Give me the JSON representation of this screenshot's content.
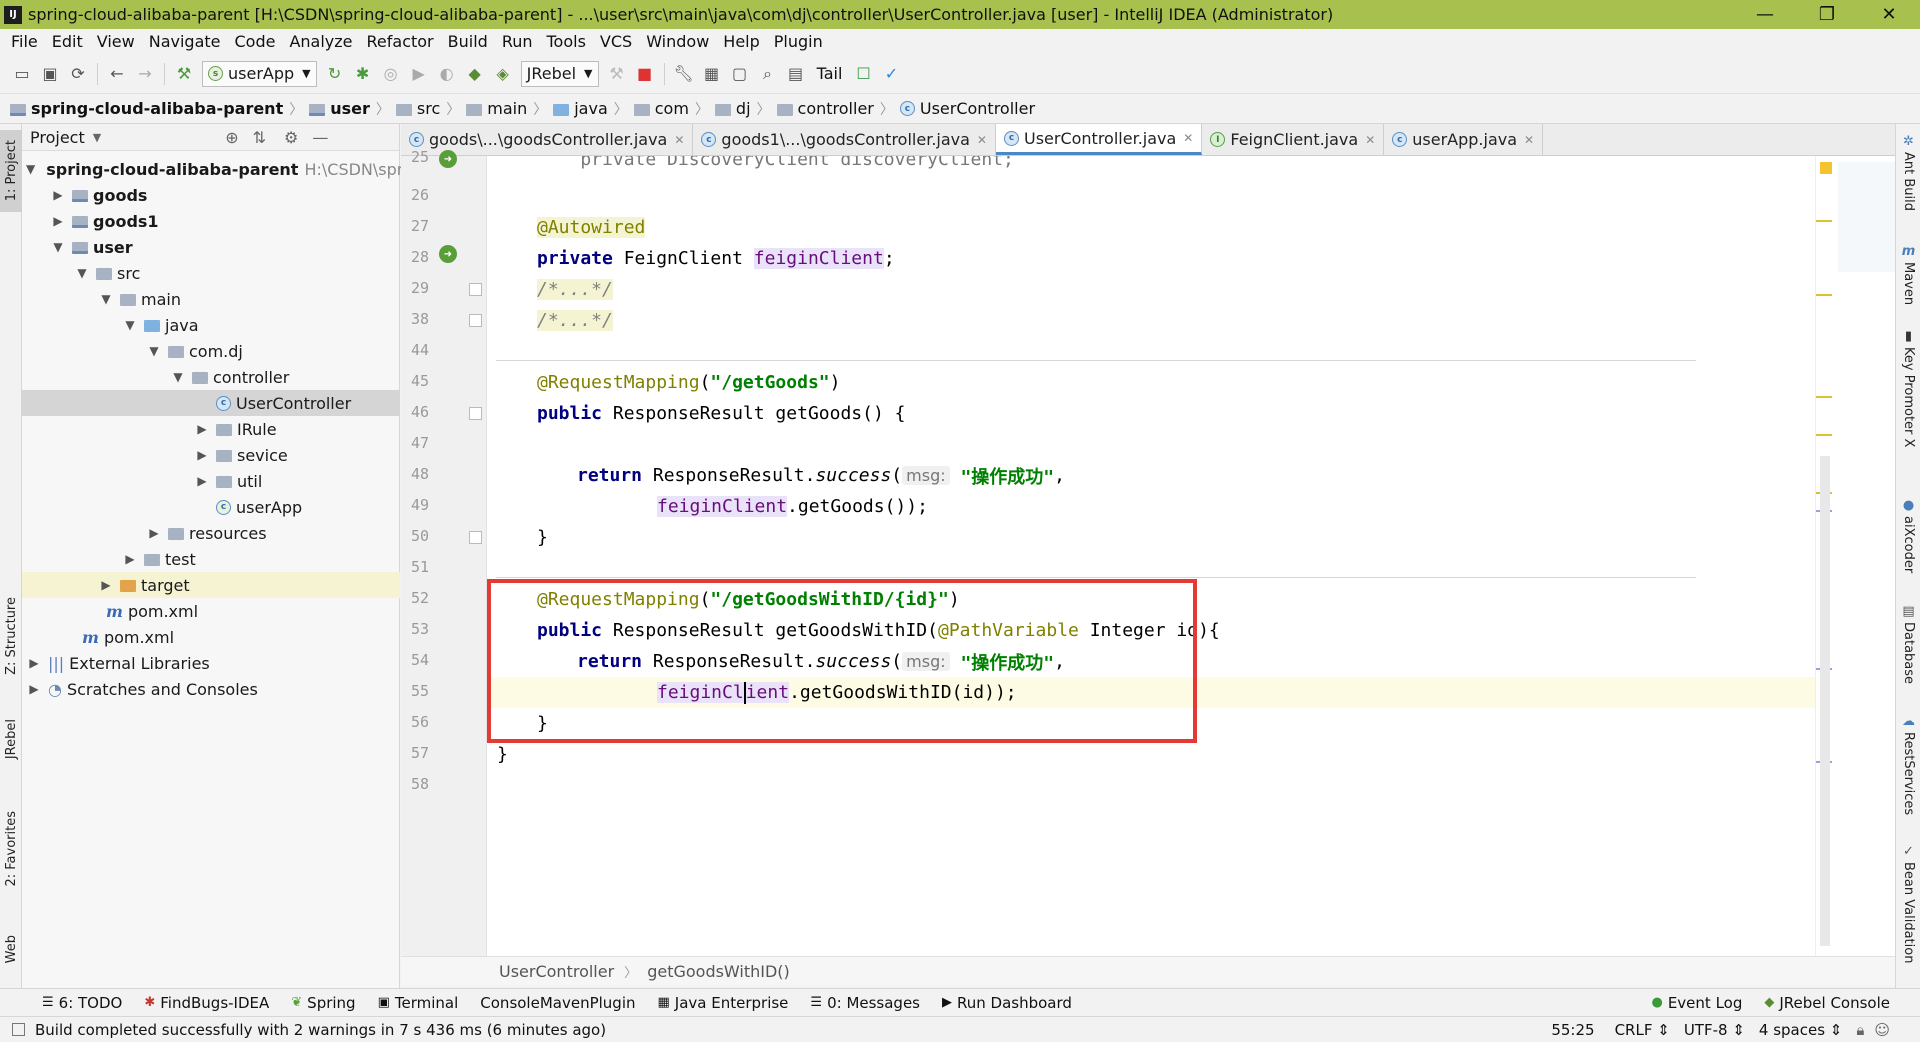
{
  "window": {
    "title": "spring-cloud-alibaba-parent [H:\\CSDN\\spring-cloud-alibaba-parent] - ...\\user\\src\\main\\java\\com\\dj\\controller\\UserController.java [user] - IntelliJ IDEA (Administrator)",
    "app_icon": "IJ",
    "minimize": "—",
    "maximize": "❐",
    "close": "✕"
  },
  "menu": [
    "File",
    "Edit",
    "View",
    "Navigate",
    "Code",
    "Analyze",
    "Refactor",
    "Build",
    "Run",
    "Tools",
    "VCS",
    "Window",
    "Help",
    "Plugin"
  ],
  "toolbar": {
    "run_config": "userApp",
    "jrebel": "JRebel",
    "tail": "Tail"
  },
  "breadcrumb": [
    "spring-cloud-alibaba-parent",
    "user",
    "src",
    "main",
    "java",
    "com",
    "dj",
    "controller",
    "UserController"
  ],
  "left_strip": {
    "project": "1: Project",
    "structure": "Z: Structure",
    "jrebel": "JRebel",
    "favorites": "2: Favorites",
    "web": "Web"
  },
  "right_strip": [
    "Ant Build",
    "Maven",
    "Key Promoter X",
    "aiXcoder",
    "Database",
    "RestServices",
    "Bean Validation"
  ],
  "project": {
    "header": "Project",
    "root_name": "spring-cloud-alibaba-parent",
    "root_path": "H:\\CSDN\\spri",
    "goods": "goods",
    "goods1": "goods1",
    "user": "user",
    "src": "src",
    "main": "main",
    "java": "java",
    "comdj": "com.dj",
    "controller": "controller",
    "usercontroller": "UserController",
    "irule": "IRule",
    "sevice": "sevice",
    "util": "util",
    "userapp": "userApp",
    "resources": "resources",
    "test": "test",
    "target": "target",
    "pom_user": "pom.xml",
    "pom_root": "pom.xml",
    "external": "External Libraries",
    "scratches": "Scratches and Consoles"
  },
  "tabs": [
    {
      "label": "goods\\...\\goodsController.java"
    },
    {
      "label": "goods1\\...\\goodsController.java"
    },
    {
      "label": "UserController.java"
    },
    {
      "label": "FeignClient.java"
    },
    {
      "label": "userApp.java"
    }
  ],
  "code": {
    "l25": [
      "25",
      "    private DiscoveryClient discoveryClient;"
    ],
    "l26": "26",
    "l27": [
      "27",
      "@Autowired"
    ],
    "l28": [
      "28",
      "private",
      "FeignClient",
      "feiginClient",
      ";"
    ],
    "l29": [
      "29",
      "/*...*/"
    ],
    "l38": [
      "38",
      "/*...*/"
    ],
    "l44": "44",
    "l45": [
      "45",
      "@RequestMapping",
      "(",
      "\"/getGoods\"",
      ")"
    ],
    "l46": [
      "46",
      "public",
      "ResponseResult getGoods() {"
    ],
    "l47": "47",
    "l48": [
      "48",
      "return",
      "ResponseResult.",
      "success",
      "(",
      "msg:",
      "\"操作成功\"",
      ","
    ],
    "l49": [
      "49",
      "feiginClient",
      ".getGoods());"
    ],
    "l50": [
      "50",
      "}"
    ],
    "l51": "51",
    "l52": [
      "52",
      "@RequestMapping",
      "(",
      "\"/getGoodsWithID/{id}\"",
      ")"
    ],
    "l53": [
      "53",
      "public",
      "ResponseResult getGoodsWithID(",
      "@PathVariable",
      " Integer id){"
    ],
    "l54": [
      "54",
      "return",
      "ResponseResult.",
      "success",
      "(",
      "msg:",
      "\"操作成功\"",
      ","
    ],
    "l55": [
      "55",
      "feiginCl",
      "ient",
      ".getGoodsWithID(id));"
    ],
    "l56": [
      "56",
      "}"
    ],
    "l57": [
      "57",
      "}"
    ],
    "l58": "58"
  },
  "editor_breadcrumb": [
    "UserController",
    "getGoodsWithID()"
  ],
  "toolwindows": [
    "6: TODO",
    "FindBugs-IDEA",
    "Spring",
    "Terminal",
    "ConsoleMavenPlugin",
    "Java Enterprise",
    "0: Messages",
    "Run Dashboard",
    "Event Log",
    "JRebel Console"
  ],
  "status": {
    "message": "Build completed successfully with 2 warnings in 7 s 436 ms (6 minutes ago)",
    "position": "55:25",
    "line_sep": "CRLF",
    "encoding": "UTF-8",
    "indent": "4 spaces"
  },
  "colors": {
    "titlebar": "#a8c14e",
    "highlight_box": "#e53935",
    "active_tab": "#4a88c7"
  }
}
